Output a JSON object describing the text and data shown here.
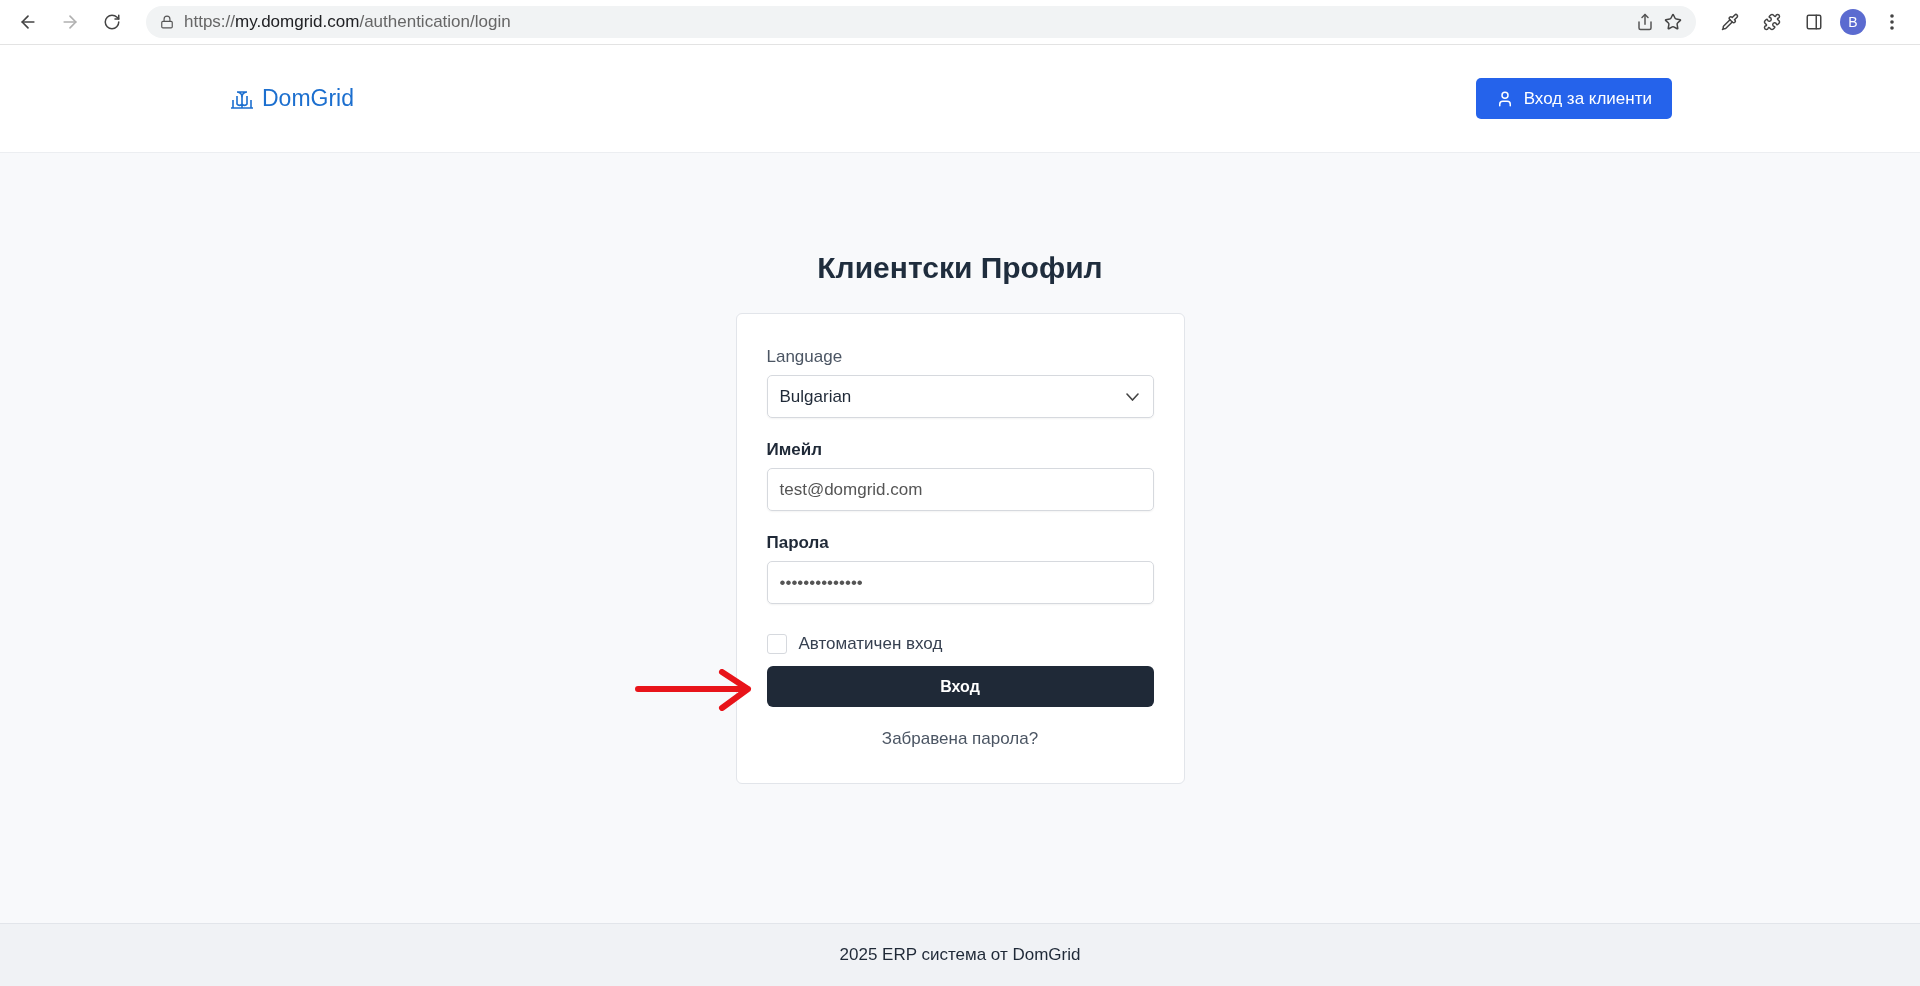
{
  "browser": {
    "url_scheme": "https://",
    "url_host": "my.domgrid.com",
    "url_path": "/authentication/login",
    "profile_letter": "B"
  },
  "header": {
    "logo": "DomGrid",
    "client_button": "Вход за клиенти"
  },
  "login": {
    "title": "Клиентски Профил",
    "fields": [
      {
        "kind": "select",
        "label": "Language",
        "value": "Bulgarian",
        "bold_label": false
      },
      {
        "kind": "input",
        "label": "Имейл",
        "value": "test@domgrid.com",
        "bold_label": true
      },
      {
        "kind": "input",
        "label": "Парола",
        "value": "••••••••••••••",
        "bold_label": true
      }
    ],
    "remember": {
      "label": "Автоматичен вход",
      "checked": false
    },
    "submit": "Вход",
    "forgot": "Забравена парола?"
  },
  "footer": {
    "text": "2025 ERP система от DomGrid"
  }
}
